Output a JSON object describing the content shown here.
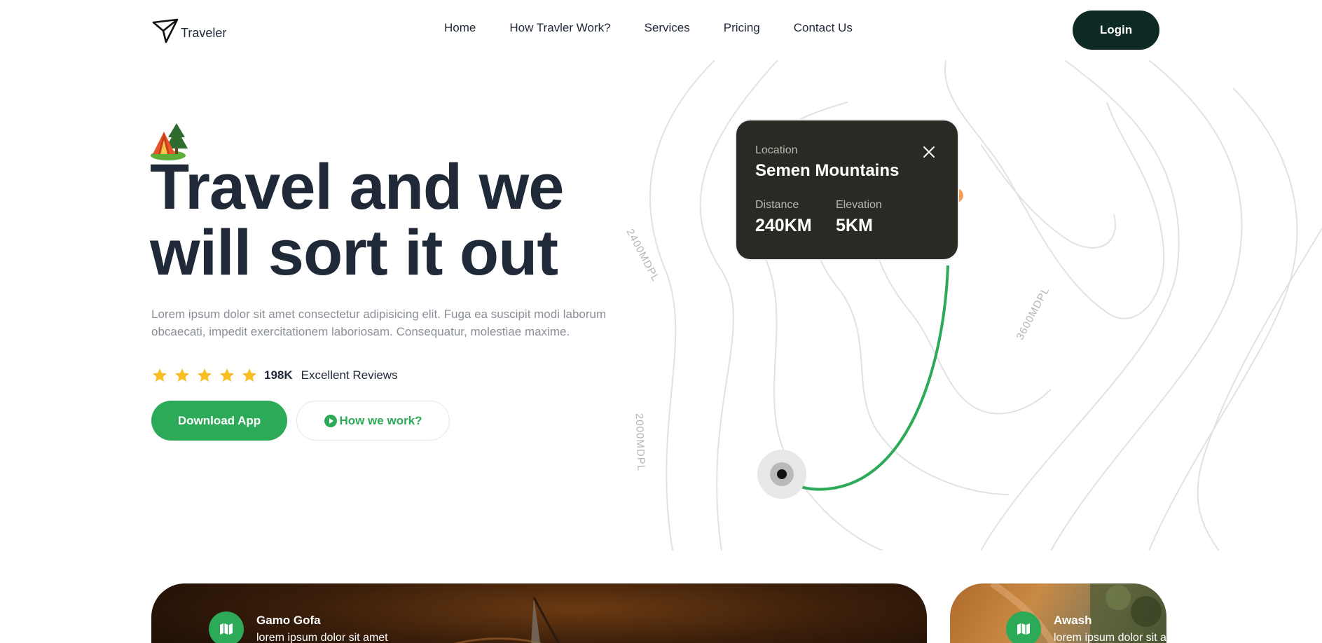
{
  "nav": {
    "logo_text": "Traveler",
    "items": [
      {
        "label": "Home"
      },
      {
        "label": "How Travler Work?"
      },
      {
        "label": "Services"
      },
      {
        "label": "Pricing"
      },
      {
        "label": "Contact Us"
      }
    ],
    "login_label": "Login"
  },
  "hero": {
    "headline_line1": "Travel and we",
    "headline_line2": "will sort it out",
    "description": "Lorem ipsum dolor sit amet consectetur adipisicing elit. Fuga ea suscipit modi laborum obcaecati, impedit exercitationem laboriosam. Consequatur, molestiae maxime.",
    "rating": {
      "stars": 5,
      "count": "198K",
      "label": "Excellent Reviews"
    },
    "download_label": "Download App",
    "how_label": "How we work?"
  },
  "map": {
    "contour_labels": [
      "2400MDPL",
      "3600MDPL",
      "2000MDPL"
    ],
    "card": {
      "location_label": "Location",
      "location_value": "Semen Mountains",
      "distance_label": "Distance",
      "distance_value": "240KM",
      "elevation_label": "Elevation",
      "elevation_value": "5KM"
    }
  },
  "destinations": [
    {
      "title": "Gamo Gofa",
      "subtitle": "lorem ipsum dolor sit amet"
    },
    {
      "title": "Awash",
      "subtitle": "lorem ipsum dolor sit amet"
    }
  ],
  "colors": {
    "accent": "#2daa58",
    "dark": "#0d2a25",
    "card_bg": "#2a2a25",
    "star": "#fbbf24"
  }
}
